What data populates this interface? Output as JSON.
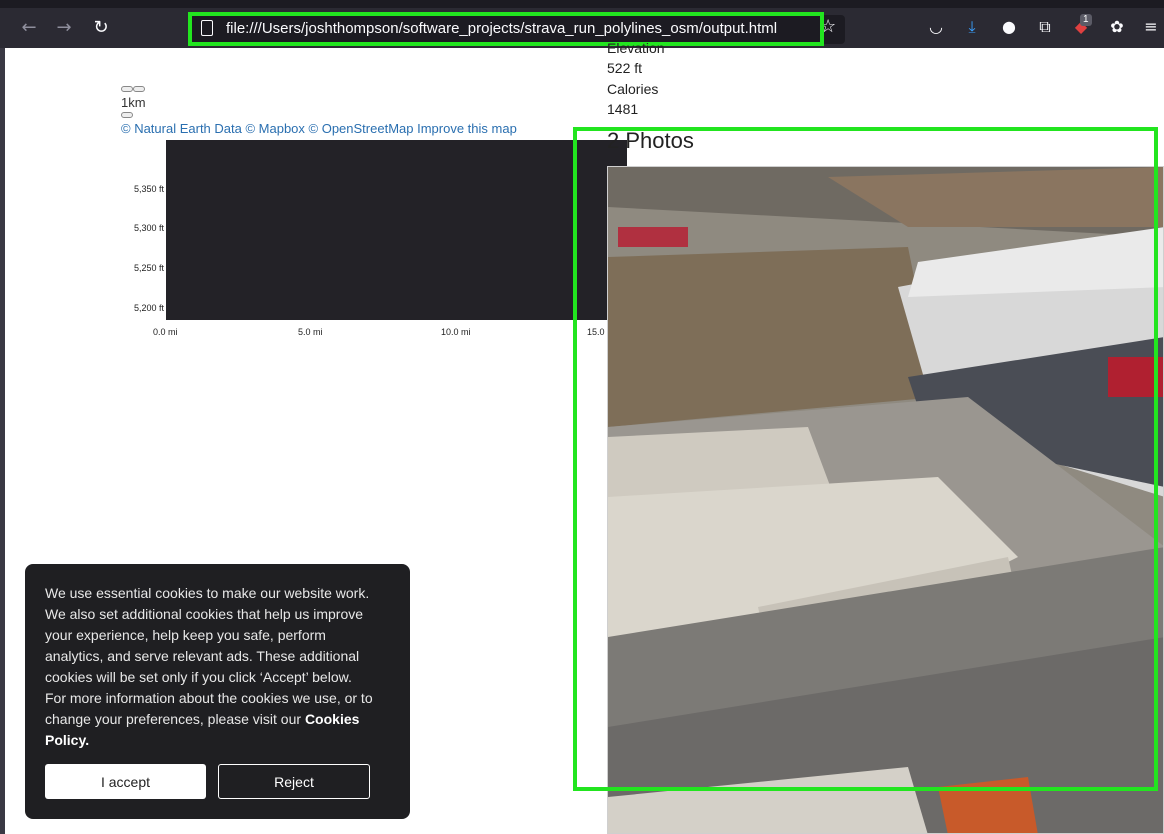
{
  "browser": {
    "url": "file:///Users/joshthompson/software_projects/strava_run_polylines_osm/output.html",
    "back_icon": "arrow-left-icon",
    "forward_icon": "arrow-right-icon",
    "reload_icon": "reload-icon",
    "extension_badge": "1"
  },
  "map": {
    "scale": "1km",
    "attribution": "© Natural Earth Data © Mapbox © OpenStreetMap Improve this map"
  },
  "elevation_chart": {
    "y_ticks": [
      "5,350 ft",
      "5,300 ft",
      "5,250 ft",
      "5,200 ft"
    ],
    "x_ticks": [
      "0.0 mi",
      "5.0 mi",
      "10.0 mi",
      "15.0"
    ]
  },
  "stats": {
    "elevation_label": "Elevation",
    "elevation_value": "522 ft",
    "calories_label": "Calories",
    "calories_value": "1481"
  },
  "photos": {
    "heading": "2 Photos"
  },
  "cookie_banner": {
    "text": "We use essential cookies to make our website work. We also set additional cookies that help us improve your experience, help keep you safe, perform analytics, and serve relevant ads. These additional cookies will be set only if you click ‘Accept’ below. For more information about the cookies we use, or to change your preferences, please visit our ",
    "policy_link": "Cookies Policy.",
    "accept_label": "I accept",
    "reject_label": "Reject"
  }
}
